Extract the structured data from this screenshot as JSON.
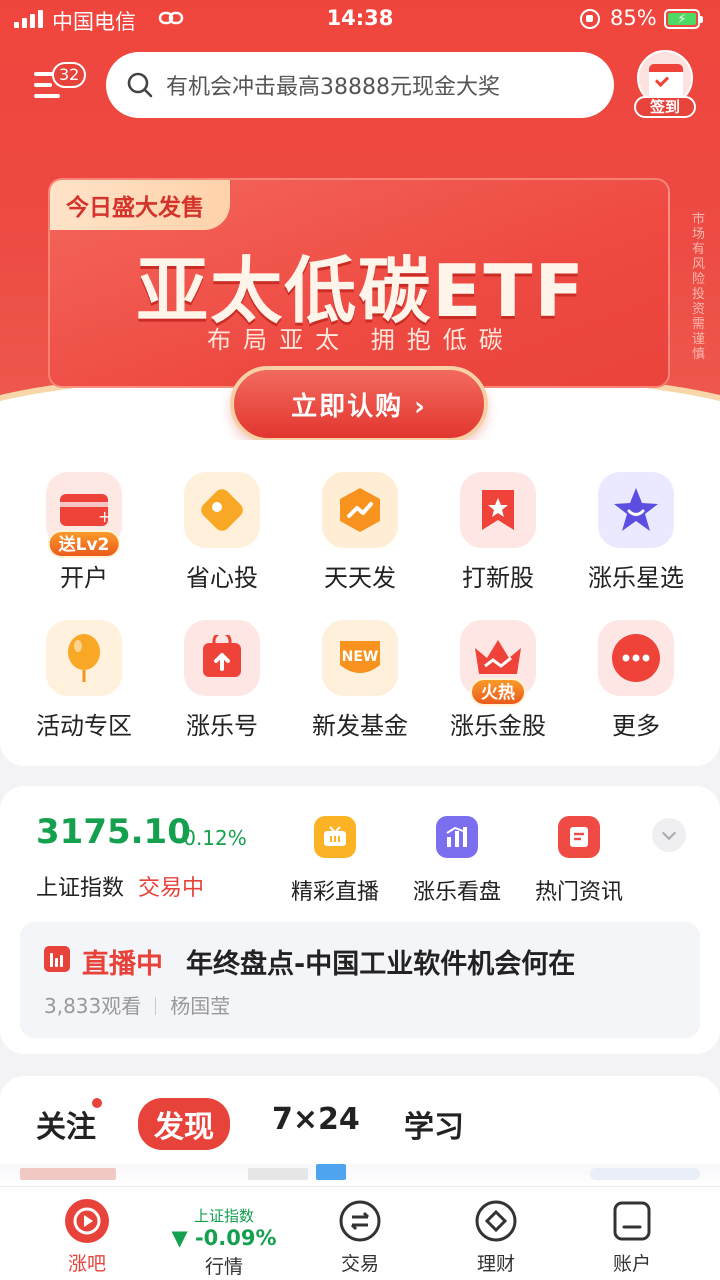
{
  "status": {
    "carrier": "中国电信",
    "time": "14:38",
    "battery": "85%"
  },
  "header": {
    "menu_badge": "32",
    "search_placeholder": "有机会冲击最高38888元现金大奖",
    "checkin_label": "签到"
  },
  "banner": {
    "tag": "今日盛大发售",
    "title": "亚太低碳ETF",
    "subtitle": "布局亚太  拥抱低碳",
    "side_note": "市场有风险 投资需谨慎",
    "cta": "立即认购 ›"
  },
  "quick_grid": [
    {
      "label": "开户",
      "icon": "card-add-icon",
      "badge": "送Lv2"
    },
    {
      "label": "省心投",
      "icon": "coin-tag-icon",
      "badge": ""
    },
    {
      "label": "天天发",
      "icon": "trend-up-icon",
      "badge": ""
    },
    {
      "label": "打新股",
      "icon": "bookmark-star-icon",
      "badge": ""
    },
    {
      "label": "涨乐星选",
      "icon": "star-icon",
      "badge": ""
    },
    {
      "label": "活动专区",
      "icon": "balloon-icon",
      "badge": ""
    },
    {
      "label": "涨乐号",
      "icon": "upload-bag-icon",
      "badge": ""
    },
    {
      "label": "新发基金",
      "icon": "new-icon",
      "badge": ""
    },
    {
      "label": "涨乐金股",
      "icon": "crown-icon",
      "badge": "火热"
    },
    {
      "label": "更多",
      "icon": "more-dots-icon",
      "badge": ""
    }
  ],
  "market": {
    "index_value": "3175.10",
    "index_change": "-0.12%",
    "index_name": "上证指数",
    "index_state": "交易中",
    "shortcuts": [
      {
        "label": "精彩直播",
        "icon": "tv-icon"
      },
      {
        "label": "涨乐看盘",
        "icon": "chart-bars-icon"
      },
      {
        "label": "热门资讯",
        "icon": "news-icon"
      }
    ],
    "live": {
      "tag": "直播中",
      "title": "年终盘点-中国工业软件机会何在",
      "views": "3,833观看",
      "host": "杨国莹"
    }
  },
  "feed_tabs": [
    "关注",
    "发现",
    "7×24",
    "学习"
  ],
  "bottom_nav": {
    "items": [
      {
        "label": "涨吧",
        "icon": "play-circle-icon"
      },
      {
        "label": "行情",
        "index_name": "上证指数",
        "index_change": "▼ -0.09%"
      },
      {
        "label": "交易",
        "icon": "exchange-icon"
      },
      {
        "label": "理财",
        "icon": "diamond-icon"
      },
      {
        "label": "账户",
        "icon": "account-icon"
      }
    ]
  },
  "colors": {
    "brand_red": "#e8433b",
    "down_green": "#14a04f"
  }
}
